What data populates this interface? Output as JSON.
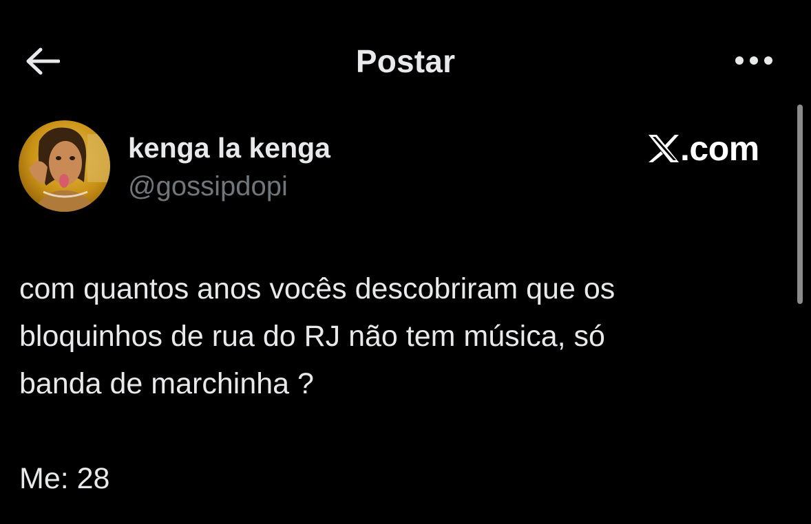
{
  "header": {
    "title": "Postar",
    "back_icon": "arrow-left-icon",
    "more_icon": "more-horizontal-icon"
  },
  "post": {
    "author": {
      "display_name": "kenga la kenga",
      "handle": "@gossipdopi"
    },
    "watermark": ".com",
    "watermark_logo": "x-logo-icon",
    "text_lines": [
      "com quantos anos vocês descobriram que os",
      "bloquinhos de rua do RJ não tem música, só",
      "banda de marchinha ?",
      "",
      "Me: 28"
    ]
  },
  "colors": {
    "background": "#000000",
    "primary_text": "#e7e9ea",
    "secondary_text": "#71767b"
  }
}
